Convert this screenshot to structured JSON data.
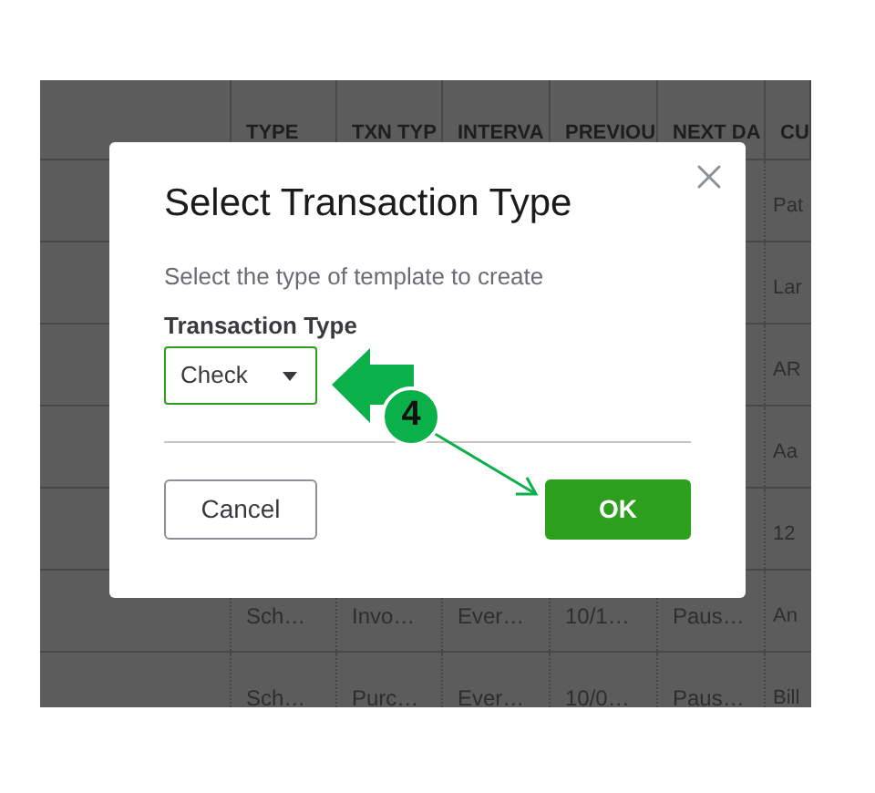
{
  "table": {
    "columns": [
      {
        "label": "TYPE"
      },
      {
        "label": "TXN TYP"
      },
      {
        "label": "INTERVA"
      },
      {
        "label": "PREVIOU"
      },
      {
        "label": "NEXT DA"
      },
      {
        "label": "CU"
      }
    ],
    "rows": [
      {
        "cells": [
          null,
          null,
          null,
          null,
          null,
          "Pat"
        ]
      },
      {
        "cells": [
          null,
          null,
          null,
          null,
          null,
          "Lar"
        ]
      },
      {
        "cells": [
          null,
          null,
          null,
          null,
          null,
          "AR"
        ]
      },
      {
        "cells": [
          null,
          null,
          null,
          null,
          null,
          "Aa"
        ]
      },
      {
        "cells": [
          null,
          null,
          null,
          null,
          null,
          "12"
        ]
      },
      {
        "cells": [
          "Sch…",
          "Invo…",
          "Ever…",
          "10/1…",
          "Paus…",
          "An"
        ]
      },
      {
        "cells": [
          "Sch…",
          "Purc…",
          "Ever…",
          "10/0…",
          "Paus…",
          "Bill"
        ]
      }
    ]
  },
  "dialog": {
    "title": "Select Transaction Type",
    "description": "Select the type of template to create",
    "field": {
      "label": "Transaction Type",
      "value": "Check"
    },
    "buttons": [
      {
        "kind": "secondary",
        "label": "Cancel"
      },
      {
        "kind": "primary",
        "label": "OK"
      }
    ]
  },
  "annotation": {
    "step": "4"
  }
}
